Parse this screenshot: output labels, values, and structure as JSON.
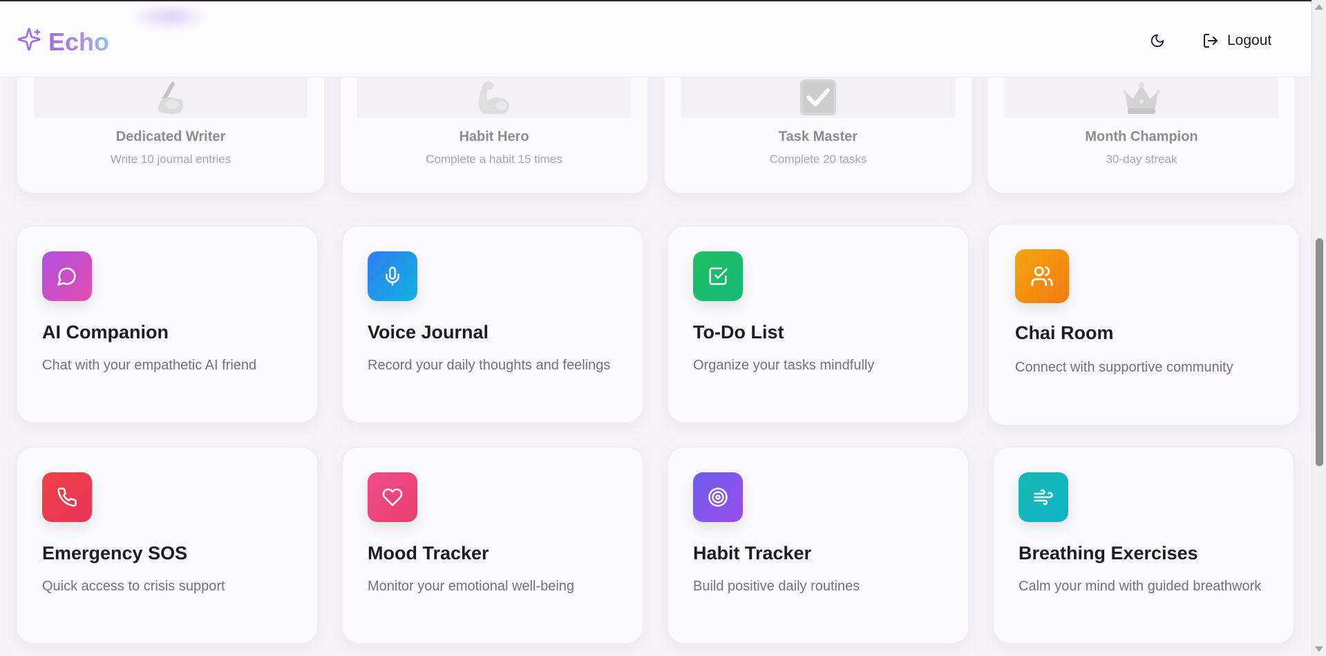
{
  "app": {
    "name": "Echo"
  },
  "header": {
    "logout_label": "Logout"
  },
  "colors": {
    "ai_companion": "#c04fd8",
    "voice_journal": "#1f8fe6",
    "todo_list": "#1fbf62",
    "chai_room": "#f59e0b",
    "emergency_sos": "#ef4455",
    "mood_tracker": "#ec4d85",
    "habit_tracker": "#8552ec",
    "breathing": "#12b5b8"
  },
  "achievements": [
    {
      "icon": "writing-hand-icon",
      "title": "Dedicated Writer",
      "desc": "Write 10 journal entries"
    },
    {
      "icon": "flexed-biceps-icon",
      "title": "Habit Hero",
      "desc": "Complete a habit 15 times"
    },
    {
      "icon": "check-box-icon",
      "title": "Task Master",
      "desc": "Complete 20 tasks"
    },
    {
      "icon": "crown-icon",
      "title": "Month Champion",
      "desc": "30-day streak"
    }
  ],
  "features": [
    {
      "icon": "message-circle-icon",
      "title": "AI Companion",
      "desc": "Chat with your empathetic AI friend"
    },
    {
      "icon": "microphone-icon",
      "title": "Voice Journal",
      "desc": "Record your daily thoughts and feelings"
    },
    {
      "icon": "check-square-icon",
      "title": "To-Do List",
      "desc": "Organize your tasks mindfully"
    },
    {
      "icon": "users-icon",
      "title": "Chai Room",
      "desc": "Connect with supportive community"
    },
    {
      "icon": "phone-icon",
      "title": "Emergency SOS",
      "desc": "Quick access to crisis support"
    },
    {
      "icon": "heart-icon",
      "title": "Mood Tracker",
      "desc": "Monitor your emotional well-being"
    },
    {
      "icon": "target-icon",
      "title": "Habit Tracker",
      "desc": "Build positive daily routines"
    },
    {
      "icon": "wind-icon",
      "title": "Breathing Exercises",
      "desc": "Calm your mind with guided breathwork"
    }
  ]
}
